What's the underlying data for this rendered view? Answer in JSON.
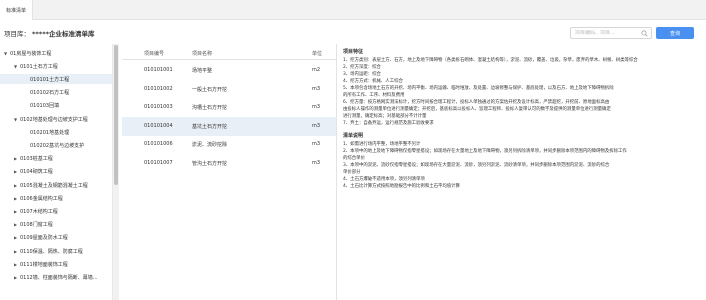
{
  "tabs": [
    {
      "label": "标准清单"
    }
  ],
  "library": {
    "label": "项目库：",
    "name": "*****企业标准清单库"
  },
  "search": {
    "placeholder": "项目编码、项目...",
    "button": "查询"
  },
  "tree": [
    {
      "label": "01房屋与装饰工程",
      "level": 0,
      "expanded": true
    },
    {
      "label": "0101土石方工程",
      "level": 1,
      "expanded": true
    },
    {
      "label": "010101土方工程",
      "level": 2,
      "selected": true
    },
    {
      "label": "010102石方工程",
      "level": 2
    },
    {
      "label": "010103回填",
      "level": 2
    },
    {
      "label": "0102地基处理与边坡支护工程",
      "level": 1,
      "expanded": true
    },
    {
      "label": "010201地基处理",
      "level": 2
    },
    {
      "label": "010202基坑与边坡支护",
      "level": 2
    },
    {
      "label": "0103桩基工程",
      "level": 1,
      "expanded": false
    },
    {
      "label": "0104砌筑工程",
      "level": 1,
      "expanded": false
    },
    {
      "label": "0105混凝土及钢筋混凝土工程",
      "level": 1,
      "expanded": false
    },
    {
      "label": "0106金属结构工程",
      "level": 1,
      "expanded": false
    },
    {
      "label": "0107木结构工程",
      "level": 1,
      "expanded": false
    },
    {
      "label": "0108门窗工程",
      "level": 1,
      "expanded": false
    },
    {
      "label": "0109屋面及防水工程",
      "level": 1,
      "expanded": false
    },
    {
      "label": "0110保温、隔热、防腐工程",
      "level": 1,
      "expanded": false
    },
    {
      "label": "0111楼地面装饰工程",
      "level": 1,
      "expanded": false
    },
    {
      "label": "0112墙、柱面装饰与隔断、幕墙...",
      "level": 1,
      "expanded": false
    }
  ],
  "grid": {
    "headers": {
      "code": "项目编号",
      "name": "项目名称",
      "unit": "单位"
    },
    "rows": [
      {
        "code": "010101001",
        "name": "场地平整",
        "unit": "m2"
      },
      {
        "code": "010101002",
        "name": "一般土石方开挖",
        "unit": "m3"
      },
      {
        "code": "010101003",
        "name": "沟槽土石方开挖",
        "unit": "m3"
      },
      {
        "code": "010101004",
        "name": "基坑土石方开挖",
        "unit": "m3",
        "selected": true
      },
      {
        "code": "010101006",
        "name": "淤泥、流砂挖除",
        "unit": "m3"
      },
      {
        "code": "010101007",
        "name": "管沟土石方开挖",
        "unit": "m3"
      }
    ]
  },
  "detail": {
    "feature_title": "项目特征",
    "feature_lines": [
      "1、挖方类别：表层土方、石方，地上及地下障碍物（各类拆石砌体、混凝土结构等），淤泥、流砂，覆盖、垃圾，杂草，废弃的草木、树根、树类等综合",
      "2、挖方深度：综合",
      "3、场内运距：综合",
      "4、挖方方式：机械、人工综合",
      "5、本项包含场地土石方的开挖、场内平衡、场内运输、临时堆放，及处置、边坡修整与保护、基底处理，以及石方、地上及地下障碍物拆除",
      "的所有工作、工序、材料及费用",
      "6、挖方量：按方格网实测法标计，挖方时间按合理工程计，投标人单独通过的方案估开挖及设计标高，严禁超挖，开挖前、原地面标高由",
      "由投标人操作的测量单位进行测量确定；开挖后，基底标高以投标人、监理工程师、投标人复审认可的数字及提供的测量单位进行测量确定",
      "进行测量，确定标高；对基础部分不计计量",
      "7、弃土：自备弃运，运行规范及施工验收要求"
    ],
    "rule_title": "清单说明",
    "rule_lines": [
      "1、如需进行场内平整，场地平整不另计",
      "2、本项中的地上及地下障碍物仅指零星搭设；如现场存在大量地上及地下障碍物，须另列拆除清单项，并同步删除本项范围内的障碍物及拆除工作",
      "的综合单价",
      "3、本项中的淤泥、流砂仅指零星搭设；如现场存在大量淤泥、流砂，须另列淤泥、流砂清单项，并同步删除本项范围内淤泥、流砂的综合",
      "单价部分",
      "4、土石方爆破不适用本项，须另列清单项",
      "4、土石比计算方式按照地勘报告中的比例和土石平均值计算"
    ]
  }
}
